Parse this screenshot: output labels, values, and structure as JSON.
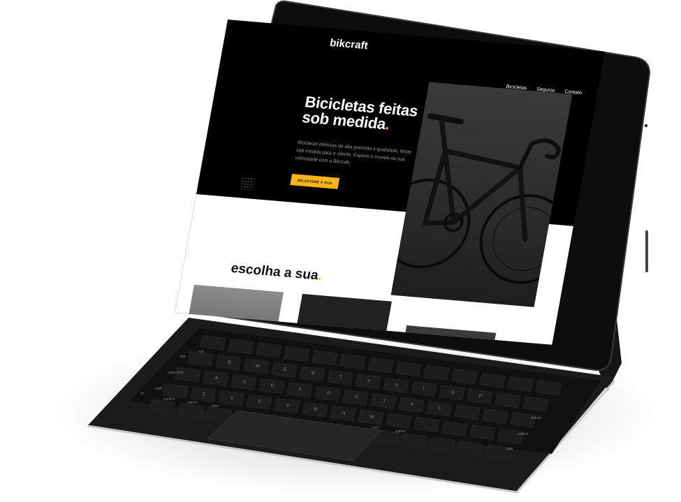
{
  "site": {
    "brand": "bikcraft",
    "nav": [
      "Bicicletas",
      "Seguros",
      "Contato"
    ]
  },
  "hero": {
    "title_line1": "Bicicletas feitas",
    "title_line2": "sob medida",
    "title_dot": ".",
    "text": "Bicicletas elétricas de alta precisão e qualidade, feitas sob medida para o cliente. Explore o mundo na sua velocidade com a Bikcraft.",
    "cta": "SELECIONE A SUA"
  },
  "section": {
    "title": "escolha a sua",
    "title_dot": "."
  },
  "colors": {
    "accent": "#FBB615",
    "screen_bg": "#000000",
    "device": "#1c1c1c"
  },
  "keyboard": {
    "keys": [
      "tab",
      "caps lock",
      "shift",
      "control",
      "option",
      "cmd",
      "cmd",
      "option",
      "delete",
      "return",
      "shift",
      "esc",
      "fn"
    ],
    "letters": [
      "Q",
      "W",
      "E",
      "R",
      "T",
      "Y",
      "U",
      "I",
      "O",
      "P",
      "A",
      "S",
      "D",
      "F",
      "G",
      "H",
      "J",
      "K",
      "L",
      "Z",
      "X",
      "C",
      "V",
      "B",
      "N",
      "M"
    ]
  }
}
